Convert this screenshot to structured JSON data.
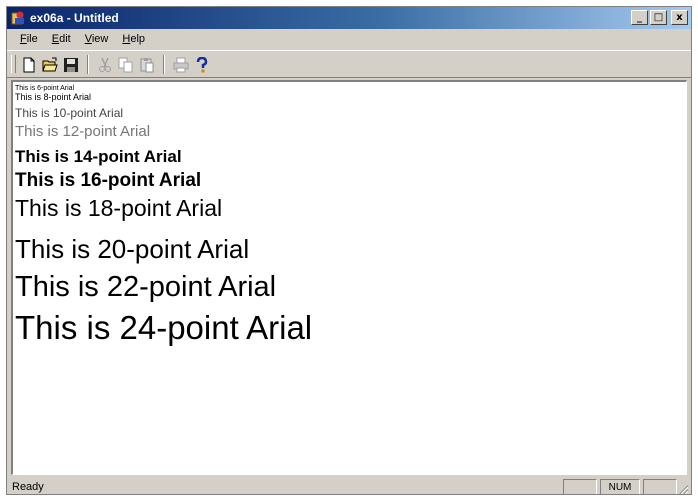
{
  "window": {
    "title": "ex06a - Untitled",
    "minimize_glyph": "_",
    "maximize_glyph": "□",
    "close_glyph": "x"
  },
  "menu": {
    "items": [
      "File",
      "Edit",
      "View",
      "Help"
    ]
  },
  "toolbar": {
    "buttons": [
      {
        "name": "new-icon",
        "enabled": true
      },
      {
        "name": "open-icon",
        "enabled": true
      },
      {
        "name": "save-icon",
        "enabled": true
      },
      {
        "name": "cut-icon",
        "enabled": false
      },
      {
        "name": "copy-icon",
        "enabled": false
      },
      {
        "name": "paste-icon",
        "enabled": false
      },
      {
        "name": "print-icon",
        "enabled": false
      },
      {
        "name": "help-icon",
        "enabled": true
      }
    ]
  },
  "document": {
    "lines": [
      "This is 6-point Arial",
      "This is 8-point Arial",
      "This is 10-point Arial",
      "This is 12-point Arial",
      "This is 14-point Arial",
      "This is 16-point Arial",
      "This is 18-point Arial",
      "This is 20-point Arial",
      "This is 22-point Arial",
      "This is 24-point Arial"
    ]
  },
  "status": {
    "text": "Ready",
    "num_indicator": "NUM"
  },
  "colors": {
    "title_active": "#0a246a",
    "face": "#d4d0c8",
    "client_bg": "#ffffff"
  }
}
